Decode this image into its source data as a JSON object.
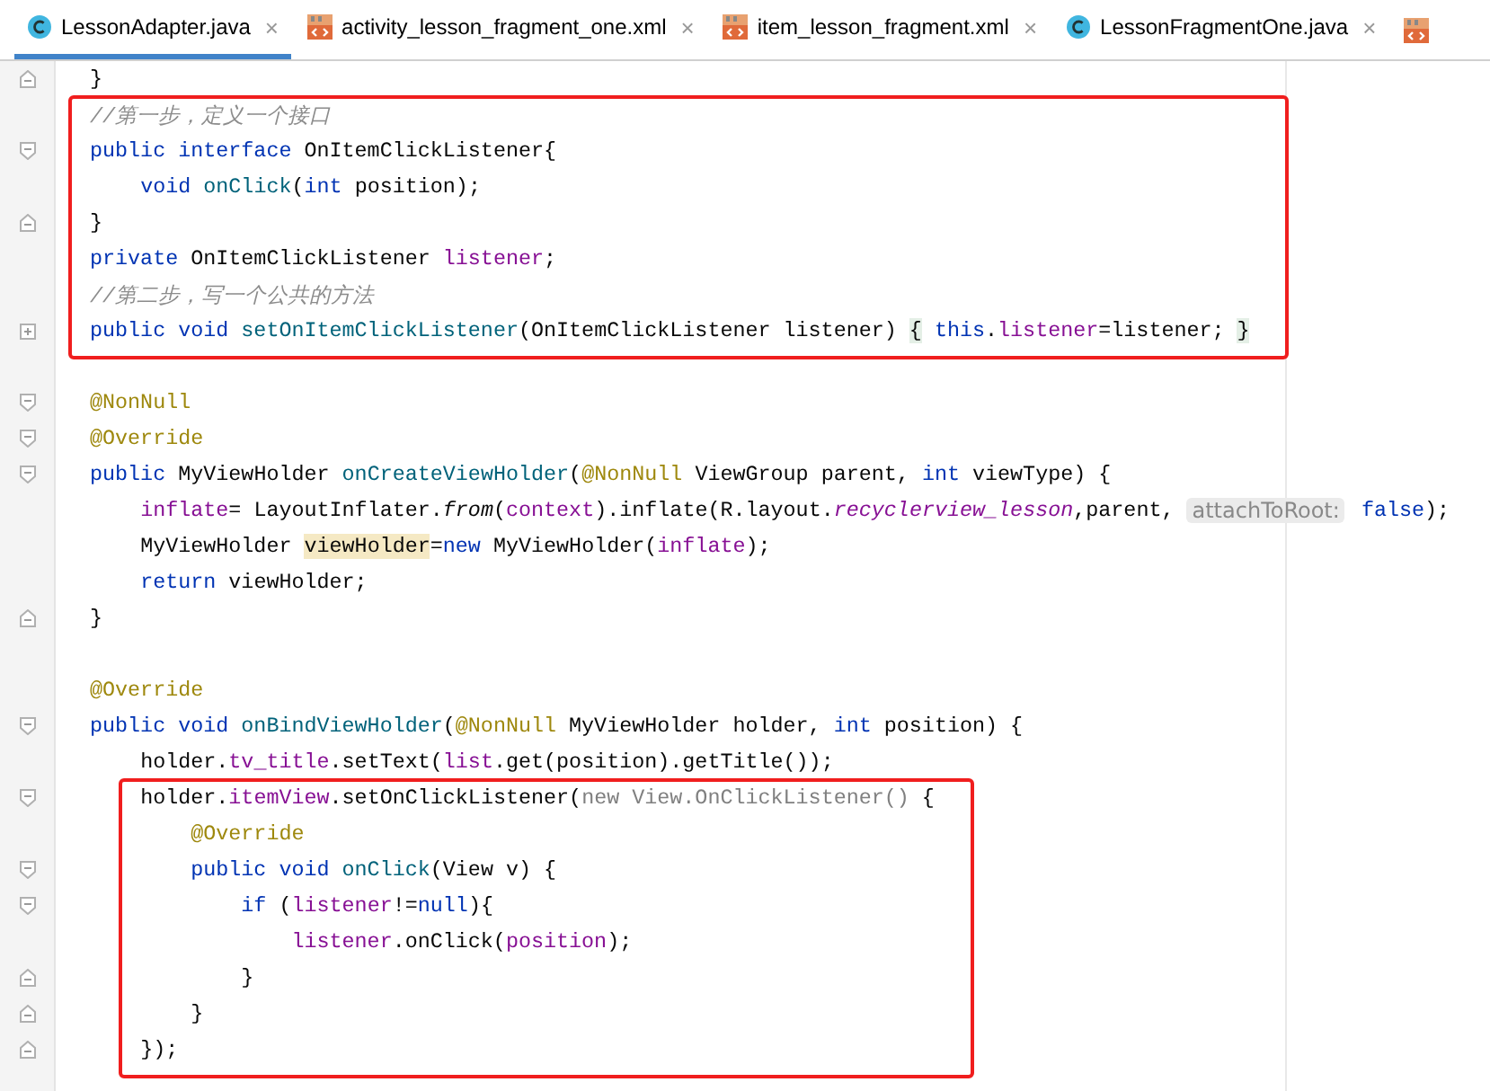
{
  "tabs": [
    {
      "label": "LessonAdapter.java",
      "kind": "java",
      "selected": true,
      "close": "×"
    },
    {
      "label": "activity_lesson_fragment_one.xml",
      "kind": "xml",
      "selected": false,
      "close": "×"
    },
    {
      "label": "item_lesson_fragment.xml",
      "kind": "xml",
      "selected": false,
      "close": "×"
    },
    {
      "label": "LessonFragmentOne.java",
      "kind": "java",
      "selected": false,
      "close": "×"
    }
  ],
  "tab_overflow": {
    "kind": "xml"
  },
  "editor": {
    "blocks": [
      {
        "boxed": false,
        "lines": [
          {
            "marker": {
              "kind": "fold-end"
            },
            "tokens": [
              {
                "kind": "plain",
                "t": "}"
              }
            ]
          }
        ]
      },
      {
        "boxed": true,
        "lines": [
          {
            "tokens": [
              {
                "kind": "comment",
                "t": "//第一步，定义一个接口"
              }
            ]
          },
          {
            "marker": {
              "kind": "fold-start"
            },
            "tokens": [
              {
                "kind": "kw",
                "t": "public interface "
              },
              {
                "kind": "plain",
                "t": "OnItemClickListener{"
              }
            ]
          },
          {
            "tokens": [
              {
                "kind": "kw",
                "t": "    void "
              },
              {
                "kind": "decl",
                "t": "onClick"
              },
              {
                "kind": "plain",
                "t": "("
              },
              {
                "kind": "kw",
                "t": "int "
              },
              {
                "kind": "plain",
                "t": "position);"
              }
            ]
          },
          {
            "marker": {
              "kind": "fold-end"
            },
            "tokens": [
              {
                "kind": "plain",
                "t": "}"
              }
            ]
          },
          {
            "tokens": [
              {
                "kind": "kw",
                "t": "private "
              },
              {
                "kind": "plain",
                "t": "OnItemClickListener "
              },
              {
                "kind": "field",
                "t": "listener"
              },
              {
                "kind": "plain",
                "t": ";"
              }
            ]
          },
          {
            "tokens": [
              {
                "kind": "comment",
                "t": "//第二步，写一个公共的方法"
              }
            ]
          },
          {
            "marker": {
              "kind": "fold-collapsed"
            },
            "tokens": [
              {
                "kind": "kw",
                "t": "public void "
              },
              {
                "kind": "decl",
                "t": "setOnItemClickListener"
              },
              {
                "kind": "plain",
                "t": "(OnItemClickListener listener) "
              },
              {
                "kind": "folded",
                "t": "{"
              },
              {
                "kind": "kw",
                "t": " this"
              },
              {
                "kind": "plain",
                "t": "."
              },
              {
                "kind": "field",
                "t": "listener"
              },
              {
                "kind": "plain",
                "t": "=listener; "
              },
              {
                "kind": "folded",
                "t": "}"
              }
            ]
          }
        ]
      },
      {
        "boxed": false,
        "gap_before": true,
        "lines": [
          {
            "marker": {
              "kind": "fold-start"
            },
            "tokens": [
              {
                "kind": "ann",
                "t": "@NonNull"
              }
            ]
          },
          {
            "marker": {
              "kind": "fold-start"
            },
            "tokens": [
              {
                "kind": "ann",
                "t": "@Override"
              }
            ]
          },
          {
            "marker": {
              "kind": "fold-start"
            },
            "tokens": [
              {
                "kind": "kw",
                "t": "public "
              },
              {
                "kind": "plain",
                "t": "MyViewHolder "
              },
              {
                "kind": "decl",
                "t": "onCreateViewHolder"
              },
              {
                "kind": "plain",
                "t": "("
              },
              {
                "kind": "ann",
                "t": "@NonNull "
              },
              {
                "kind": "plain",
                "t": "ViewGroup parent, "
              },
              {
                "kind": "kw",
                "t": "int "
              },
              {
                "kind": "plain",
                "t": "viewType) {"
              }
            ]
          },
          {
            "tokens": [
              {
                "kind": "field",
                "t": "    inflate"
              },
              {
                "kind": "plain",
                "t": "= LayoutInflater."
              },
              {
                "kind": "static",
                "t": "from"
              },
              {
                "kind": "plain",
                "t": "("
              },
              {
                "kind": "field",
                "t": "context"
              },
              {
                "kind": "plain",
                "t": ").inflate(R.layout."
              },
              {
                "kind": "const",
                "t": "recyclerview_lesson"
              },
              {
                "kind": "plain",
                "t": ",parent, "
              },
              {
                "kind": "hint",
                "t": "attachToRoot:"
              },
              {
                "kind": "kw",
                "t": " false"
              },
              {
                "kind": "plain",
                "t": ");"
              }
            ]
          },
          {
            "tokens": [
              {
                "kind": "plain",
                "t": "    MyViewHolder "
              },
              {
                "kind": "mark",
                "t": "viewHolder"
              },
              {
                "kind": "plain",
                "t": "="
              },
              {
                "kind": "kw",
                "t": "new "
              },
              {
                "kind": "plain",
                "t": "MyViewHolder("
              },
              {
                "kind": "field",
                "t": "inflate"
              },
              {
                "kind": "plain",
                "t": ");"
              }
            ]
          },
          {
            "tokens": [
              {
                "kind": "kw",
                "t": "    return "
              },
              {
                "kind": "plain",
                "t": "viewHolder;"
              }
            ]
          },
          {
            "marker": {
              "kind": "fold-end"
            },
            "tokens": [
              {
                "kind": "plain",
                "t": "}"
              }
            ]
          }
        ]
      },
      {
        "boxed": false,
        "gap_before": true,
        "lines": [
          {
            "tokens": [
              {
                "kind": "ann",
                "t": "@Override"
              }
            ]
          },
          {
            "marker": {
              "kind": "fold-start"
            },
            "tokens": [
              {
                "kind": "kw",
                "t": "public void "
              },
              {
                "kind": "decl",
                "t": "onBindViewHolder"
              },
              {
                "kind": "plain",
                "t": "("
              },
              {
                "kind": "ann",
                "t": "@NonNull "
              },
              {
                "kind": "plain",
                "t": "MyViewHolder holder, "
              },
              {
                "kind": "kw",
                "t": "int "
              },
              {
                "kind": "plain",
                "t": "position) {"
              }
            ]
          },
          {
            "tokens": [
              {
                "kind": "plain",
                "t": "    holder."
              },
              {
                "kind": "field",
                "t": "tv_title"
              },
              {
                "kind": "plain",
                "t": ".setText("
              },
              {
                "kind": "field",
                "t": "list"
              },
              {
                "kind": "plain",
                "t": ".get(position).getTitle());"
              }
            ]
          }
        ]
      },
      {
        "boxed": true,
        "lines": [
          {
            "marker": {
              "kind": "fold-start"
            },
            "tokens": [
              {
                "kind": "plain",
                "t": "    holder."
              },
              {
                "kind": "field",
                "t": "itemView"
              },
              {
                "kind": "plain",
                "t": ".setOnClickListener("
              },
              {
                "kind": "dim",
                "t": "new View.OnClickListener()"
              },
              {
                "kind": "plain",
                "t": " {"
              }
            ]
          },
          {
            "tokens": [
              {
                "kind": "ann",
                "t": "        @Override"
              }
            ]
          },
          {
            "marker": {
              "kind": "fold-start"
            },
            "tokens": [
              {
                "kind": "kw",
                "t": "        public void "
              },
              {
                "kind": "decl",
                "t": "onClick"
              },
              {
                "kind": "plain",
                "t": "(View v) {"
              }
            ]
          },
          {
            "marker": {
              "kind": "fold-start"
            },
            "tokens": [
              {
                "kind": "kw",
                "t": "            if "
              },
              {
                "kind": "plain",
                "t": "("
              },
              {
                "kind": "field",
                "t": "listener"
              },
              {
                "kind": "plain",
                "t": "!="
              },
              {
                "kind": "kw",
                "t": "null"
              },
              {
                "kind": "plain",
                "t": "){"
              }
            ]
          },
          {
            "tokens": [
              {
                "kind": "field",
                "t": "                listener"
              },
              {
                "kind": "plain",
                "t": ".onClick("
              },
              {
                "kind": "field",
                "t": "position"
              },
              {
                "kind": "plain",
                "t": ");"
              }
            ]
          },
          {
            "marker": {
              "kind": "fold-end"
            },
            "tokens": [
              {
                "kind": "plain",
                "t": "            }"
              }
            ]
          },
          {
            "marker": {
              "kind": "fold-end"
            },
            "tokens": [
              {
                "kind": "plain",
                "t": "        }"
              }
            ]
          },
          {
            "marker": {
              "kind": "fold-end"
            },
            "tokens": [
              {
                "kind": "plain",
                "t": "    });"
              }
            ]
          }
        ]
      }
    ]
  }
}
